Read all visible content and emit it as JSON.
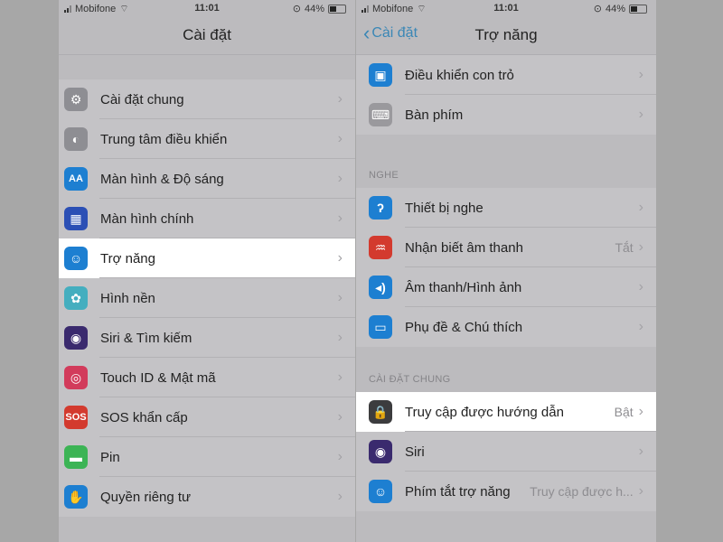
{
  "status_bar": {
    "carrier": "Mobifone",
    "time": "11:01",
    "battery": "44%"
  },
  "left_screen": {
    "title": "Cài đặt",
    "items": [
      {
        "label": "Cài đặt chung",
        "icon": "gear-icon",
        "color": "#8e8e93"
      },
      {
        "label": "Trung tâm điều khiển",
        "icon": "toggles-icon",
        "color": "#8e8e93"
      },
      {
        "label": "Màn hình & Độ sáng",
        "icon": "text-size-icon",
        "glyph": "AA",
        "color": "#1d7fd1"
      },
      {
        "label": "Màn hình chính",
        "icon": "home-grid-icon",
        "color": "#2b4fb5"
      },
      {
        "label": "Trợ năng",
        "icon": "accessibility-icon",
        "color": "#1d7fd1",
        "highlighted": true
      },
      {
        "label": "Hình nền",
        "icon": "wallpaper-flower-icon",
        "color": "#44aebf"
      },
      {
        "label": "Siri & Tìm kiếm",
        "icon": "siri-icon",
        "color": "#3a2a6e"
      },
      {
        "label": "Touch ID & Mật mã",
        "icon": "fingerprint-icon",
        "color": "#d23b5b"
      },
      {
        "label": "SOS khẩn cấp",
        "icon": "sos-icon",
        "glyph": "SOS",
        "color": "#d33a2e"
      },
      {
        "label": "Pin",
        "icon": "battery-icon",
        "color": "#3cb455"
      },
      {
        "label": "Quyền riêng tư",
        "icon": "hand-icon",
        "color": "#1d7fd1"
      }
    ]
  },
  "right_screen": {
    "back_label": "Cài đặt",
    "title": "Trợ năng",
    "top_items": [
      {
        "label": "Điều khiển con trỏ",
        "icon": "pointer-control-icon",
        "color": "#1d7fd1"
      },
      {
        "label": "Bàn phím",
        "icon": "keyboard-icon",
        "color": "#9a999d"
      }
    ],
    "hearing": {
      "header": "NGHE",
      "items": [
        {
          "label": "Thiết bị nghe",
          "icon": "ear-icon",
          "color": "#1d7fd1"
        },
        {
          "label": "Nhận biết âm thanh",
          "icon": "sound-recognition-icon",
          "color": "#d33a2e",
          "value": "Tắt"
        },
        {
          "label": "Âm thanh/Hình ảnh",
          "icon": "audio-visual-icon",
          "color": "#1d7fd1"
        },
        {
          "label": "Phụ đề & Chú thích",
          "icon": "subtitles-icon",
          "color": "#1d7fd1"
        }
      ]
    },
    "general": {
      "header": "CÀI ĐẶT CHUNG",
      "items": [
        {
          "label": "Truy cập được hướng dẫn",
          "icon": "lock-icon",
          "color": "#3c3c3e",
          "value": "Bật",
          "highlighted": true
        },
        {
          "label": "Siri",
          "icon": "siri-icon",
          "color": "#3a2a6e"
        },
        {
          "label": "Phím tắt trợ năng",
          "icon": "accessibility-icon",
          "color": "#1d7fd1",
          "value": "Truy cập được h..."
        }
      ]
    }
  }
}
